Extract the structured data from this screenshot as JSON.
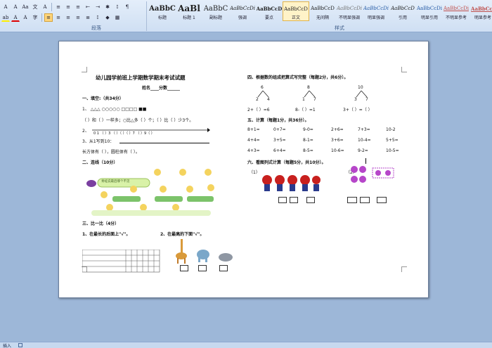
{
  "ribbon": {
    "font_group_label": "段落",
    "styles_group_label": "样式",
    "styles": [
      {
        "sample": "AaBbC",
        "name": "标题"
      },
      {
        "sample": "AaBl",
        "name": "标题 1"
      },
      {
        "sample": "AaBbC",
        "name": "副标题"
      },
      {
        "sample": "AaBbCcDi",
        "name": "强调"
      },
      {
        "sample": "AaBbCcD",
        "name": "要点"
      },
      {
        "sample": "AaBbCcD",
        "name": "正文"
      },
      {
        "sample": "AaBbCcD",
        "name": "无间隔"
      },
      {
        "sample": "AaBbCcDi",
        "name": "不明显强调"
      },
      {
        "sample": "AaBbCcDi",
        "name": "明显强调"
      },
      {
        "sample": "AaBbCcD",
        "name": "引用"
      },
      {
        "sample": "AaBbCcDi",
        "name": "明显引用"
      },
      {
        "sample": "AaBbCcDi",
        "name": "不明显参考"
      },
      {
        "sample": "AaBbCcI",
        "name": "明显参考"
      }
    ],
    "selected_style": "正文"
  },
  "doc": {
    "title": "幼儿园学前班上学期数学期末考试试题",
    "name_line": "姓名____分数______",
    "s1": "一、填空:（共34分）",
    "s1_q1": "1、   △△△  ○○○○○  □□□□   ■■",
    "s1_q1b": "（    ）和（    ）一样多；○比△多（    ）个；（    ）比（    ）少3个。",
    "s1_q2": "2、",
    "s1_q2_scale": "0     1    （  ）3     （  ）（  ）（  ）7   （  ）9（  ）",
    "s1_q3": "3、从1写到10：",
    "s1_q3b": "长方体有（      ），圆柱体有（              ）。",
    "s2": "二、连线（10分）",
    "s3": "三、比一比（4分）",
    "s3_q1": "1、在最长的后面上\"√\"。",
    "s3_q2": "2、在最高的下面\"√\"。",
    "s4": "四、根据数的组成把算式写完整（每题2分，共6分）。",
    "s4_trees": [
      [
        "6",
        "2",
        "4"
      ],
      [
        "8",
        "1",
        "7"
      ],
      [
        "10",
        "3",
        "7"
      ]
    ],
    "s4_eqs": [
      "2+（    ）=6",
      "8-（    ）=1",
      "3+（    ）=（    ）"
    ],
    "s5": "五、计算（每题1分，共36分）。",
    "s5_rows": [
      [
        "8+1=",
        "0+7=",
        "9-0=",
        "2+6=",
        "7+3=",
        "10-2"
      ],
      [
        "4+4=",
        "3+5=",
        "8-1=",
        "3+6=",
        "10-4=",
        "5+5="
      ],
      [
        "4+3=",
        "6+4=",
        "8-5=",
        "10-6=",
        "9-2=",
        "10-5="
      ]
    ],
    "s6": "六、看图列式计算（每题5分，共10分）。",
    "s6_q1": "（1）",
    "s6_q2": "（2）",
    "banner_text": "青蛙说最后哪个不见"
  },
  "status": {
    "left": "插入"
  }
}
